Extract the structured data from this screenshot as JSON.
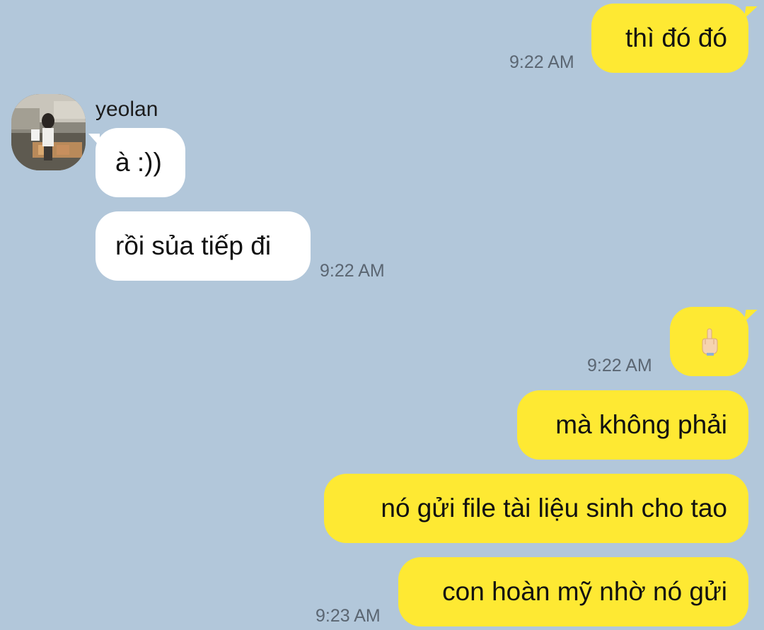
{
  "chat": {
    "messages": [
      {
        "id": "m1",
        "direction": "outgoing",
        "text": "thì đó đó",
        "time": "9:22 AM"
      },
      {
        "id": "m2",
        "direction": "incoming",
        "sender": "yeolan",
        "text": "à :))"
      },
      {
        "id": "m3",
        "direction": "incoming",
        "text": "rồi sủa tiếp đi",
        "time": "9:22 AM"
      },
      {
        "id": "m4",
        "direction": "outgoing",
        "emoji": "middle-finger-emoji",
        "time": "9:22 AM"
      },
      {
        "id": "m5",
        "direction": "outgoing",
        "text": "mà không phải"
      },
      {
        "id": "m6",
        "direction": "outgoing",
        "text": "nó gửi file tài liệu sinh cho tao"
      },
      {
        "id": "m7",
        "direction": "outgoing",
        "text": "con hoàn mỹ nhờ nó gửi",
        "time": "9:23 AM"
      }
    ],
    "incoming_sender": "yeolan"
  },
  "colors": {
    "background": "#b2c7da",
    "outgoing_bubble": "#fee933",
    "incoming_bubble": "#ffffff",
    "timestamp": "#5b6672"
  }
}
